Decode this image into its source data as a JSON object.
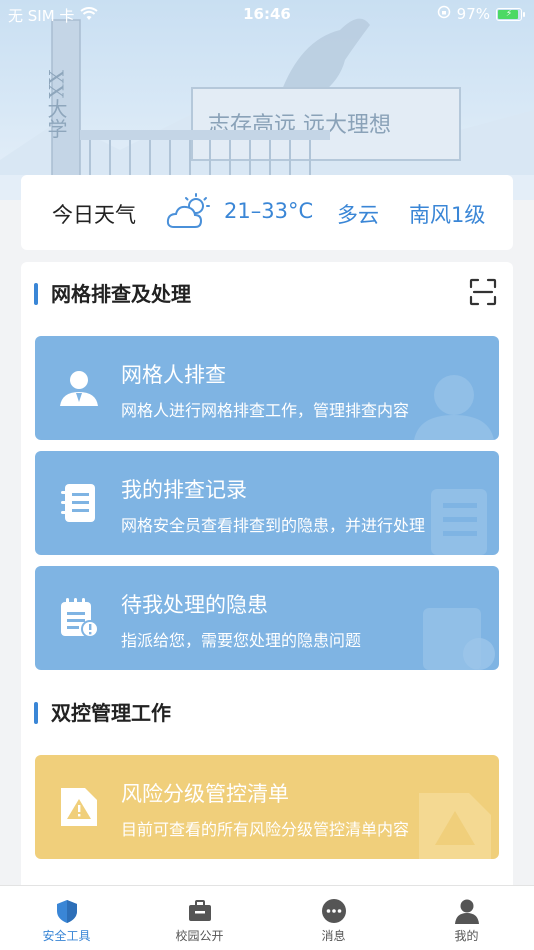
{
  "status_bar": {
    "carrier": "无 SIM 卡",
    "time": "16:46",
    "battery": "97%",
    "battery_level": 0.97
  },
  "banner": {
    "pillar_text": "XX大学",
    "sign_text": "志存高远  远大理想"
  },
  "weather": {
    "title": "今日天气",
    "temperature": "21–33°C",
    "condition": "多云",
    "wind": "南风1级",
    "icon": "partly-cloudy-icon"
  },
  "grid_section": {
    "title": "网格排查及处理",
    "scan_icon": "scan-icon",
    "cards": [
      {
        "title": "网格人排查",
        "desc": "网格人进行网格排查工作，管理排查内容",
        "icon": "inspector-icon"
      },
      {
        "title": "我的排查记录",
        "desc": "网格安全员查看排查到的隐患，并进行处理",
        "icon": "record-icon"
      },
      {
        "title": "待我处理的隐患",
        "desc": "指派给您，需要您处理的隐患问题",
        "icon": "hazard-notepad-icon"
      }
    ]
  },
  "dual_section": {
    "title": "双控管理工作",
    "cards": [
      {
        "title": "风险分级管控清单",
        "desc": "目前可查看的所有风险分级管控清单内容",
        "icon": "warning-document-icon"
      }
    ]
  },
  "tabs": [
    {
      "label": "安全工具",
      "icon": "shield-icon",
      "active": true
    },
    {
      "label": "校园公开",
      "icon": "briefcase-icon",
      "active": false
    },
    {
      "label": "消息",
      "icon": "message-icon",
      "active": false
    },
    {
      "label": "我的",
      "icon": "profile-icon",
      "active": false
    }
  ],
  "colors": {
    "accent": "#3a86d6",
    "card_blue": "#7fb4e3",
    "card_yellow": "#f0cf7b"
  }
}
